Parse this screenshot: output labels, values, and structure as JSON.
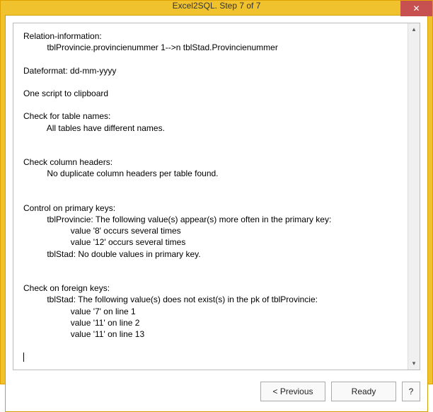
{
  "window": {
    "title": "Excel2SQL. Step 7 of 7",
    "close_glyph": "✕"
  },
  "report": {
    "relation_header": "Relation-information:",
    "relation_line": "tblProvincie.provincienummer 1-->n tblStad.Provincienummer",
    "dateformat": "Dateformat: dd-mm-yyyy",
    "clipboard": "One script to clipboard",
    "tablenames_header": "Check for table names:",
    "tablenames_result": "All tables have different names.",
    "colheaders_header": "Check column headers:",
    "colheaders_result": "No duplicate column headers per table found.",
    "pk_header": "Control on primary keys:",
    "pk_tblprov": "tblProvincie: The following value(s) appear(s) more often in the primary key:",
    "pk_val8": "value '8' occurs several times",
    "pk_val12": "value '12' occurs several times",
    "pk_tblstad": "tblStad: No double values in primary key.",
    "fk_header": "Check on foreign keys:",
    "fk_tblstad": "tblStad: The following value(s) does not exist(s) in the pk of tblProvincie:",
    "fk_v1": "value '7' on line 1",
    "fk_v2": "value '11' on line 2",
    "fk_v3": "value '11' on line 13"
  },
  "buttons": {
    "previous": "< Previous",
    "ready": "Ready",
    "help": "?"
  },
  "scroll": {
    "up": "▴",
    "down": "▾"
  }
}
